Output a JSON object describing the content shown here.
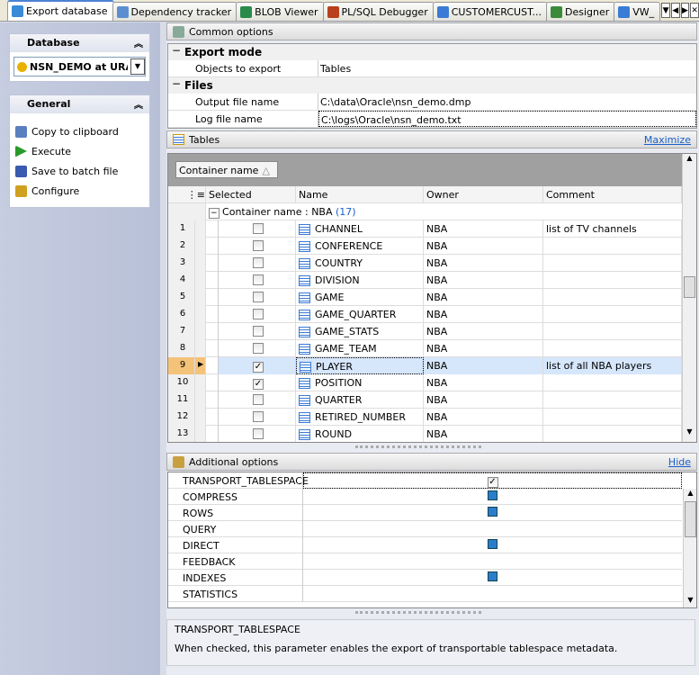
{
  "tabs": [
    {
      "label": "Export database",
      "active": true
    },
    {
      "label": "Dependency tracker"
    },
    {
      "label": "BLOB Viewer"
    },
    {
      "label": "PL/SQL Debugger"
    },
    {
      "label": "CUSTOMERCUST..."
    },
    {
      "label": "Designer"
    },
    {
      "label": "VW_"
    }
  ],
  "left": {
    "database_title": "Database",
    "database_value": "NSN_DEMO at URAI",
    "general_title": "General",
    "items": [
      "Copy to clipboard",
      "Execute",
      "Save to batch file",
      "Configure"
    ]
  },
  "common": {
    "title": "Common options",
    "export_mode": "Export mode",
    "objects_label": "Objects to export",
    "objects_value": "Tables",
    "files": "Files",
    "output_label": "Output file name",
    "output_value": "C:\\data\\Oracle\\nsn_demo.dmp",
    "log_label": "Log file name",
    "log_value": "C:\\logs\\Oracle\\nsn_demo.txt"
  },
  "tables": {
    "title": "Tables",
    "maximize": "Maximize",
    "group_button": "Container name",
    "columns": [
      "Selected",
      "Name",
      "Owner",
      "Comment"
    ],
    "group_label": "Container name : NBA",
    "group_count": "(17)",
    "rows": [
      {
        "n": "1",
        "name": "CHANNEL",
        "owner": "NBA",
        "comment": "list of TV channels",
        "checked": false
      },
      {
        "n": "2",
        "name": "CONFERENCE",
        "owner": "NBA",
        "comment": "",
        "checked": false
      },
      {
        "n": "3",
        "name": "COUNTRY",
        "owner": "NBA",
        "comment": "",
        "checked": false
      },
      {
        "n": "4",
        "name": "DIVISION",
        "owner": "NBA",
        "comment": "",
        "checked": false
      },
      {
        "n": "5",
        "name": "GAME",
        "owner": "NBA",
        "comment": "",
        "checked": false
      },
      {
        "n": "6",
        "name": "GAME_QUARTER",
        "owner": "NBA",
        "comment": "",
        "checked": false
      },
      {
        "n": "7",
        "name": "GAME_STATS",
        "owner": "NBA",
        "comment": "",
        "checked": false
      },
      {
        "n": "8",
        "name": "GAME_TEAM",
        "owner": "NBA",
        "comment": "",
        "checked": false
      },
      {
        "n": "9",
        "name": "PLAYER",
        "owner": "NBA",
        "comment": "list of all NBA players",
        "checked": true,
        "selected": true
      },
      {
        "n": "10",
        "name": "POSITION",
        "owner": "NBA",
        "comment": "",
        "checked": true
      },
      {
        "n": "11",
        "name": "QUARTER",
        "owner": "NBA",
        "comment": "",
        "checked": false
      },
      {
        "n": "12",
        "name": "RETIRED_NUMBER",
        "owner": "NBA",
        "comment": "",
        "checked": false
      },
      {
        "n": "13",
        "name": "ROUND",
        "owner": "NBA",
        "comment": "",
        "checked": false
      }
    ]
  },
  "additional": {
    "title": "Additional options",
    "hide": "Hide",
    "options": [
      {
        "name": "TRANSPORT_TABLESPACE",
        "value": "checked"
      },
      {
        "name": "COMPRESS",
        "value": "on"
      },
      {
        "name": "ROWS",
        "value": "on"
      },
      {
        "name": "QUERY",
        "value": ""
      },
      {
        "name": "DIRECT",
        "value": "on"
      },
      {
        "name": "FEEDBACK",
        "value": ""
      },
      {
        "name": "INDEXES",
        "value": "on"
      },
      {
        "name": "STATISTICS",
        "value": ""
      }
    ]
  },
  "description": {
    "title": "TRANSPORT_TABLESPACE",
    "text": "When checked, this parameter enables the export of transportable tablespace metadata."
  }
}
